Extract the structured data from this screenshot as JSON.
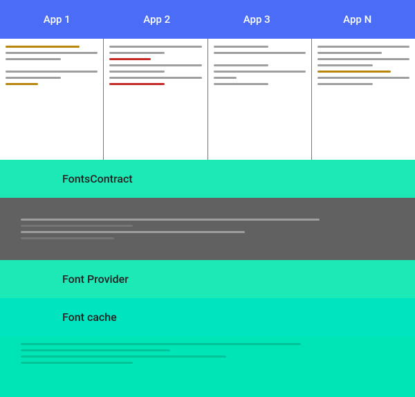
{
  "appBar": {
    "tabs": [
      {
        "label": "App 1"
      },
      {
        "label": "App 2"
      },
      {
        "label": "App 3"
      },
      {
        "label": "App N"
      }
    ]
  },
  "diagram": {
    "fontsContract": {
      "label": "FontsContract"
    },
    "fontProvider": {
      "label": "Font Provider"
    },
    "fontCache": {
      "label": "Font cache"
    }
  }
}
